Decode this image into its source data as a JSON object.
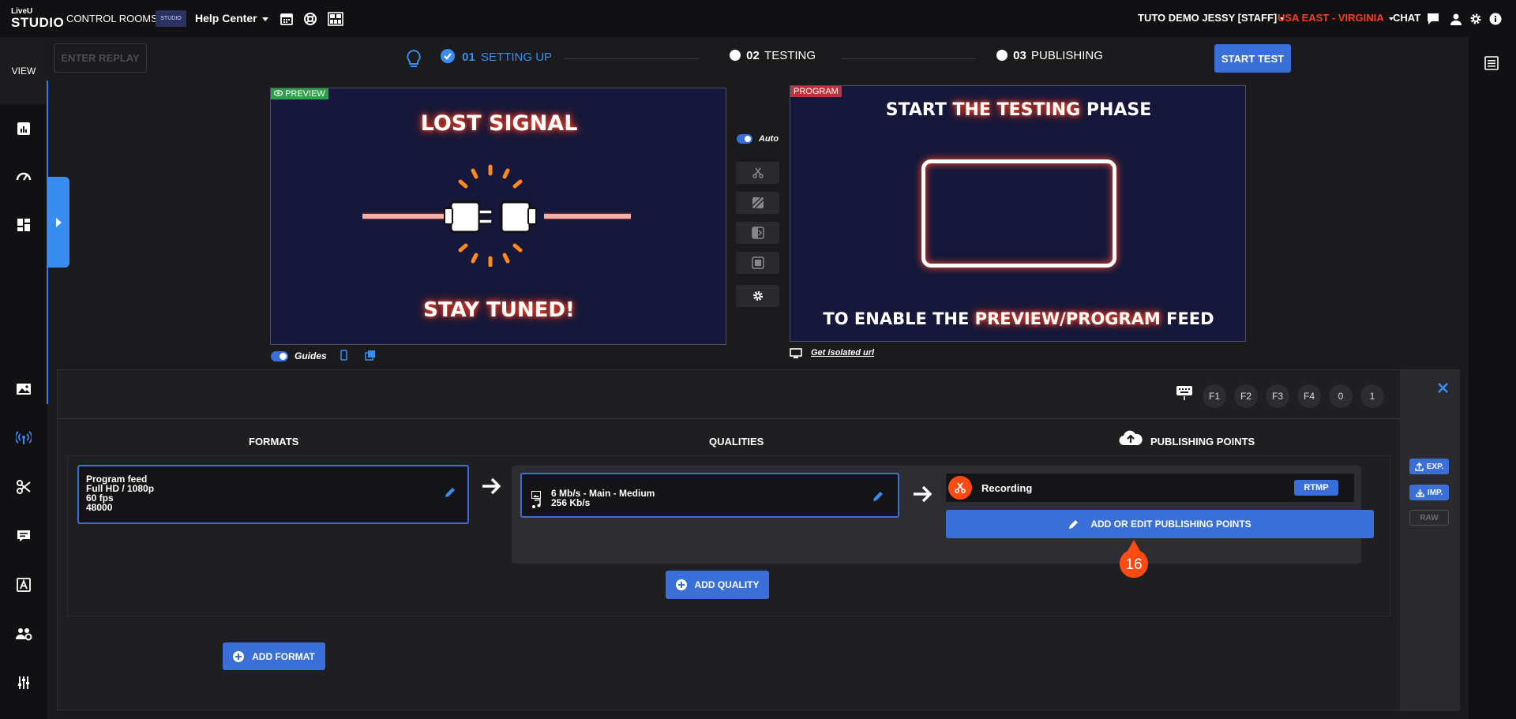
{
  "app": {
    "logo_top": "LiveU",
    "logo_bottom": "STUDIO",
    "control_rooms": "CONTROL ROOMS",
    "brand_box": "STUDIO",
    "help_center": "Help Center"
  },
  "user": {
    "name": "TUTO DEMO JESSY [STAFF]",
    "region": "USA EAST - VIRGINIA",
    "chat": "CHAT"
  },
  "colors": {
    "accent": "#3a6fd8",
    "region": "#ff3b1e",
    "preview_tag": "#2fa04a",
    "program_tag": "#c0323a",
    "record": "#ff4a12"
  },
  "leftnav": {
    "view": "VIEW",
    "icons": [
      "chart-icon",
      "dashboard-gauge-icon",
      "layout-grid-icon",
      "image-icon",
      "broadcast-icon",
      "scissors-icon",
      "subtitles-icon",
      "text-icon",
      "users-gear-icon",
      "sliders-icon"
    ]
  },
  "toolbar": {
    "replay": "ENTER REPLAY",
    "start_test": "START TEST"
  },
  "steps": [
    {
      "num": "01",
      "label": "SETTING UP",
      "state": "done"
    },
    {
      "num": "02",
      "label": "TESTING",
      "state": "pending"
    },
    {
      "num": "03",
      "label": "PUBLISHING",
      "state": "pending"
    }
  ],
  "preview": {
    "tag": "PREVIEW",
    "title": "LOST SIGNAL",
    "subtitle": "STAY TUNED!",
    "guides": "Guides"
  },
  "program": {
    "tag": "PROGRAM",
    "line1_a": "START ",
    "line1_b": "THE TESTING",
    "line1_c": " PHASE",
    "line2_a": "TO ENABLE THE ",
    "line2_b": "PREVIEW/PROGRAM",
    "line2_c": " FEED",
    "isolated": "Get isolated url"
  },
  "switcher": {
    "auto": "Auto"
  },
  "fkeys": [
    "F1",
    "F2",
    "F3",
    "F4",
    "0",
    "1"
  ],
  "formats": {
    "header": "FORMATS",
    "card": {
      "line1": "Program feed",
      "line2": "Full HD / 1080p",
      "line3": "60 fps",
      "line4": "48000"
    },
    "add": "ADD FORMAT"
  },
  "qualities": {
    "header": "QUALITIES",
    "card": {
      "video": "6 Mb/s  -  Main  -  Medium",
      "audio": "256 Kb/s"
    },
    "add": "ADD QUALITY"
  },
  "publishing": {
    "header": "PUBLISHING POINTS",
    "item_name": "Recording",
    "item_type": "RTMP",
    "edit": "ADD OR EDIT PUBLISHING POINTS"
  },
  "side_tools": {
    "exp": "EXP.",
    "imp": "IMP.",
    "raw": "RAW"
  },
  "step_badge": "16"
}
